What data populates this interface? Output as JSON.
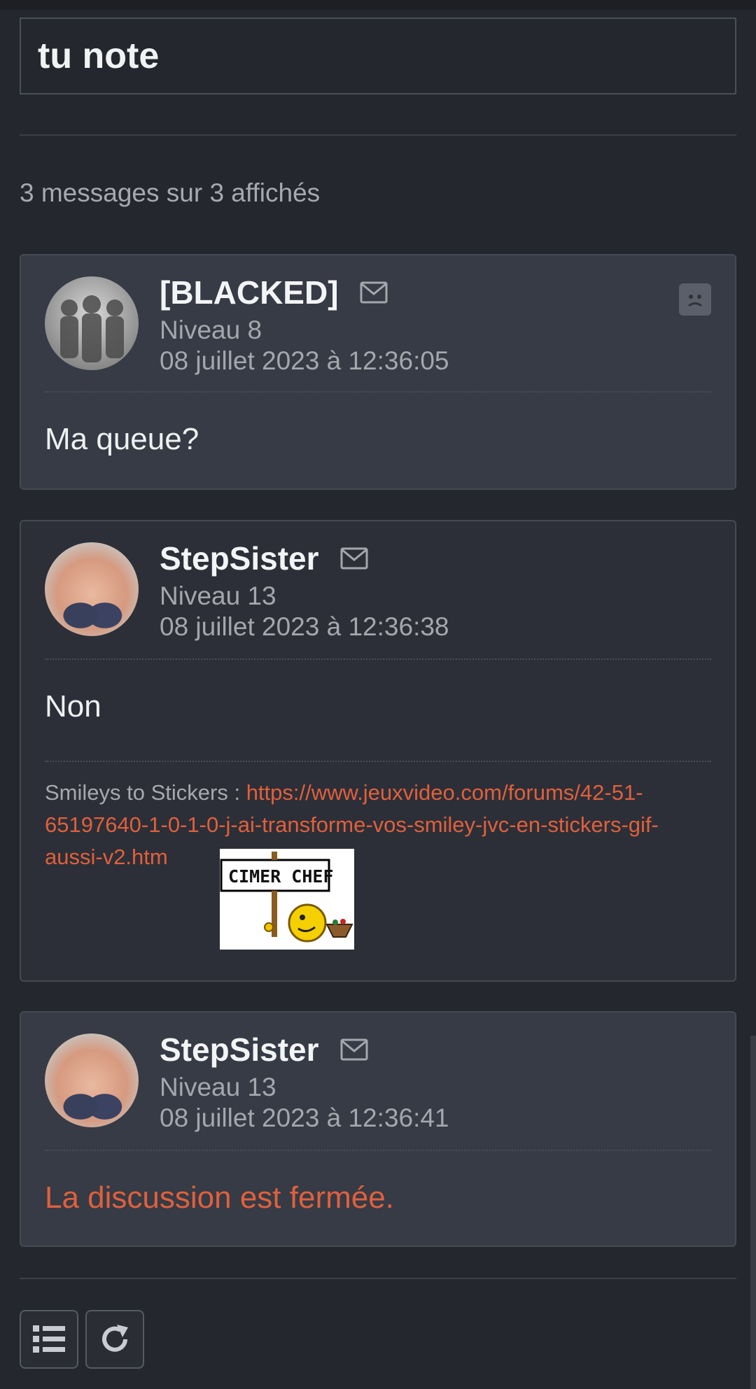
{
  "topic": {
    "title": "tu note"
  },
  "meta": {
    "count_text": "3 messages sur 3 affichés"
  },
  "messages": [
    {
      "author": "[BLACKED]",
      "level": "Niveau 8",
      "date": "08 juillet 2023 à 12:36:05",
      "content": "Ma queue?"
    },
    {
      "author": "StepSister",
      "level": "Niveau 13",
      "date": "08 juillet 2023 à 12:36:38",
      "content": "Non",
      "signature": {
        "prefix": "Smileys to Stickers : ",
        "link": "https://www.jeuxvideo.com/forums/42-51-65197640-1-0-1-0-j-ai-transforme-vos-smiley-jvc-en-stickers-gif-aussi-v2.htm",
        "sticker_text": "CIMER CHEF"
      }
    },
    {
      "author": "StepSister",
      "level": "Niveau 13",
      "date": "08 juillet 2023 à 12:36:41",
      "content": "La discussion est fermée."
    }
  ],
  "toolbar": {
    "list_icon": "list-icon",
    "refresh_icon": "refresh-icon"
  },
  "colors": {
    "background": "#24272d",
    "accent": "#e0603d",
    "card_alt": "#363b45",
    "card": "#2c2f37"
  }
}
